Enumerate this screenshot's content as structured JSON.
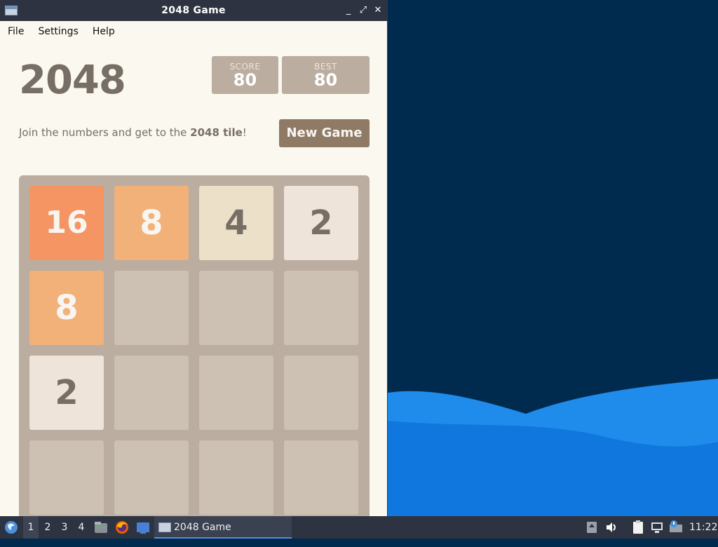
{
  "window": {
    "title": "2048 Game",
    "menu": [
      "File",
      "Settings",
      "Help"
    ]
  },
  "game": {
    "title": "2048",
    "score_label": "SCORE",
    "score": "80",
    "best_label": "BEST",
    "best": "80",
    "intro_prefix": "Join the numbers and get to the ",
    "intro_bold": "2048 tile",
    "intro_suffix": "!",
    "new_game": "New Game",
    "grid": [
      [
        "16",
        "8",
        "4",
        "2"
      ],
      [
        "8",
        "",
        "",
        ""
      ],
      [
        "2",
        "",
        "",
        ""
      ],
      [
        "",
        "",
        "",
        ""
      ]
    ],
    "tile_colors": {
      "2": {
        "bg": "#eee4da",
        "fg": "#776e65"
      },
      "4": {
        "bg": "#ede0c8",
        "fg": "#776e65"
      },
      "8": {
        "bg": "#f2b179",
        "fg": "#f9f6f2"
      },
      "16": {
        "bg": "#f59563",
        "fg": "#f9f6f2"
      }
    }
  },
  "taskbar": {
    "workspaces": [
      "1",
      "2",
      "3",
      "4"
    ],
    "active_workspace": "1",
    "task_title": "2048 Game",
    "clock": "11:22",
    "icons": [
      "start-menu-icon",
      "file-manager-icon",
      "firefox-icon",
      "desktop-icon",
      "update-icon",
      "volume-icon",
      "clipboard-icon",
      "network-icon",
      "notification-icon"
    ]
  }
}
